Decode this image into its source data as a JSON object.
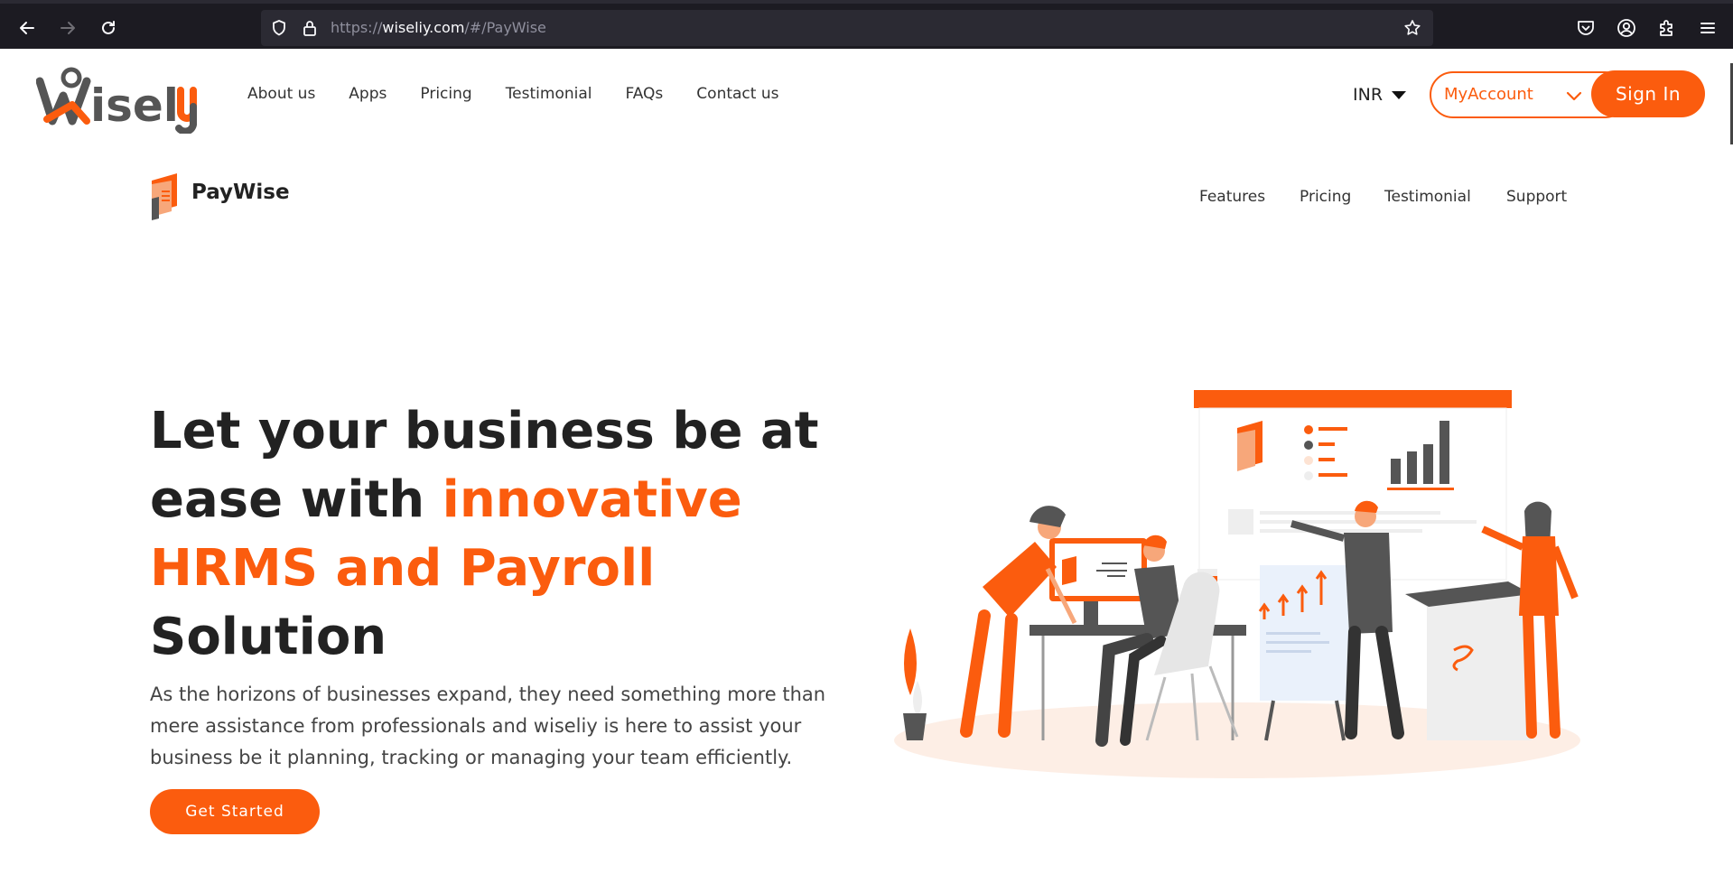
{
  "browser": {
    "url_prefix": "https://",
    "url_domain": "wiseliy.com",
    "url_path": "/#/PayWise"
  },
  "header": {
    "logo_text": "wiseliy",
    "nav": [
      "About us",
      "Apps",
      "Pricing",
      "Testimonial",
      "FAQs",
      "Contact us"
    ],
    "currency": "INR",
    "myaccount_label": "MyAccount",
    "signin_label": "Sign In"
  },
  "product": {
    "name": "PayWise",
    "nav": [
      "Features",
      "Pricing",
      "Testimonial",
      "Support"
    ]
  },
  "hero": {
    "title_part1": "Let your business be at ease with ",
    "title_accent": "innovative HRMS and Payroll",
    "title_part2": " Solution",
    "description": "As the horizons of businesses expand, they need something more than mere assistance from professionals and wiseliy is here to assist your business be it planning, tracking or managing your team efficiently.",
    "cta_label": "Get Started"
  },
  "colors": {
    "accent": "#fb5c0e",
    "text_dark": "#222222",
    "browser_bg": "#1c1b22"
  },
  "icons": [
    "back-arrow-icon",
    "forward-arrow-icon",
    "reload-icon",
    "shield-icon",
    "lock-icon",
    "star-icon",
    "pocket-icon",
    "account-icon",
    "extensions-icon",
    "menu-icon",
    "chevron-down-icon",
    "caret-down-icon"
  ]
}
